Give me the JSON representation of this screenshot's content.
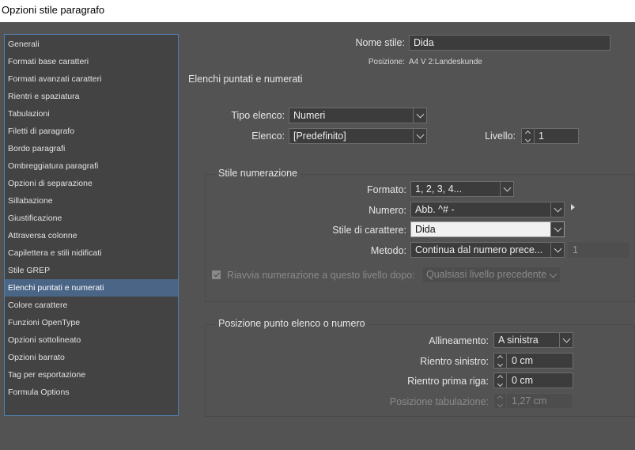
{
  "window": {
    "title": "Opzioni stile paragrafo"
  },
  "sidebar": {
    "items": [
      {
        "label": "Generali"
      },
      {
        "label": "Formati base caratteri"
      },
      {
        "label": "Formati avanzati caratteri"
      },
      {
        "label": "Rientri e spaziatura"
      },
      {
        "label": "Tabulazioni"
      },
      {
        "label": "Filetti di paragrafo"
      },
      {
        "label": "Bordo paragrafi"
      },
      {
        "label": "Ombreggiatura paragrafi"
      },
      {
        "label": "Opzioni di separazione"
      },
      {
        "label": "Sillabazione"
      },
      {
        "label": "Giustificazione"
      },
      {
        "label": "Attraversa colonne"
      },
      {
        "label": "Capilettera e stili nidificati"
      },
      {
        "label": "Stile GREP"
      },
      {
        "label": "Elenchi puntati e numerati",
        "selected": true
      },
      {
        "label": "Colore carattere"
      },
      {
        "label": "Funzioni OpenType"
      },
      {
        "label": "Opzioni sottolineato"
      },
      {
        "label": "Opzioni barrato"
      },
      {
        "label": "Tag per esportazione"
      },
      {
        "label": "Formula Options"
      }
    ]
  },
  "header": {
    "style_name_label": "Nome stile:",
    "style_name_value": "Dida",
    "position_label": "Posizione:",
    "position_value": "A4 V 2:Landeskunde",
    "section_title": "Elenchi puntati e numerati"
  },
  "list": {
    "type_label": "Tipo elenco:",
    "type_value": "Numeri",
    "list_label": "Elenco:",
    "list_value": "[Predefinito]",
    "level_label": "Livello:",
    "level_value": "1"
  },
  "numbering": {
    "group_title": "Stile numerazione",
    "format_label": "Formato:",
    "format_value": "1, 2, 3, 4...",
    "number_label": "Numero:",
    "number_value": "Abb. ^# -",
    "char_style_label": "Stile di carattere:",
    "char_style_value": "Dida",
    "method_label": "Metodo:",
    "method_value": "Continua dal numero prece...",
    "method_start": "1",
    "restart_label": "Riavvia numerazione a questo livello dopo:",
    "restart_checked": true,
    "restart_value": "Qualsiasi livello precedente"
  },
  "position": {
    "group_title": "Posizione punto elenco o numero",
    "alignment_label": "Allineamento:",
    "alignment_value": "A sinistra",
    "left_indent_label": "Rientro sinistro:",
    "left_indent_value": "0 cm",
    "first_line_label": "Rientro prima riga:",
    "first_line_value": "0 cm",
    "tab_position_label": "Posizione tabulazione:",
    "tab_position_value": "1,27 cm"
  },
  "colors": {
    "background": "#535353",
    "sidebar_bg": "#434343",
    "selection": "#4a6585",
    "field_bg": "#3c3c3c",
    "text": "#e6e6e6"
  }
}
